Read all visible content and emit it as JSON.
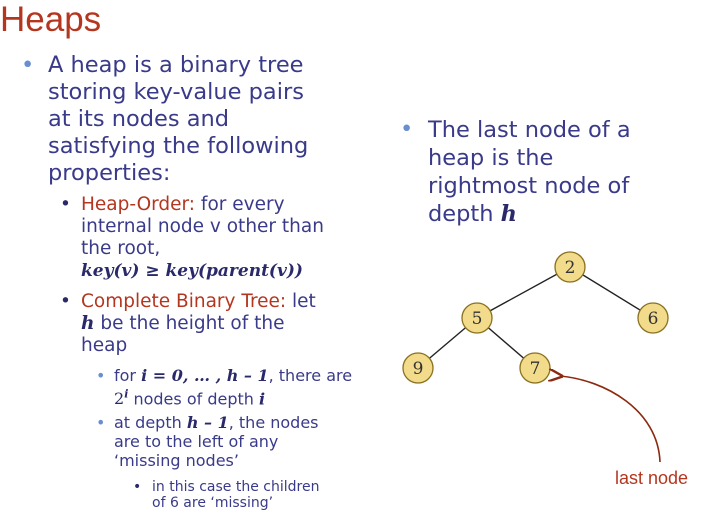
{
  "title": "Heaps",
  "left": {
    "intro_lines": [
      "A heap is a binary tree",
      "storing key-value pairs",
      "at its nodes and",
      "satisfying the following",
      "properties:"
    ],
    "heap_order": {
      "label": "Heap-Order:",
      "text1": " for every",
      "line2": "internal node v other than",
      "line3": "the root,",
      "formula": "key(v) ≥ key(parent(v))"
    },
    "complete": {
      "label": "Complete Binary Tree:",
      "text1": " let",
      "line2_var": "h",
      "line2": " be the height of the",
      "line3": "heap"
    },
    "sub1": {
      "line1_pre": "for ",
      "line1_math": "i = 0, … , h – 1",
      "line1_post": ", there are",
      "line2_math": "2i",
      "line2": " nodes of depth ",
      "line2_var": "i"
    },
    "sub2": {
      "line1_pre": "at depth ",
      "line1_math": "h – 1",
      "line1_post": ", the nodes",
      "line2": "are to the left of any",
      "line3": "‘missing nodes’"
    },
    "sub3": {
      "line1": "in this case the children",
      "line2": "of 6 are ‘missing’"
    }
  },
  "right": {
    "lines": [
      "The last node of a",
      "heap is the",
      "rightmost node of",
      "depth "
    ],
    "var": "h"
  },
  "tree": {
    "nodes": [
      {
        "id": "root",
        "key": "2"
      },
      {
        "id": "left",
        "key": "5"
      },
      {
        "id": "right",
        "key": "6"
      },
      {
        "id": "ll",
        "key": "9"
      },
      {
        "id": "lr",
        "key": "7"
      }
    ],
    "last_node_label": "last node"
  },
  "colors": {
    "title": "#b5361f",
    "text": "#3a3a8a",
    "bullet": "#6a8fd0",
    "node_fill": "#f2dc8c",
    "arrow": "#8b2a10"
  }
}
